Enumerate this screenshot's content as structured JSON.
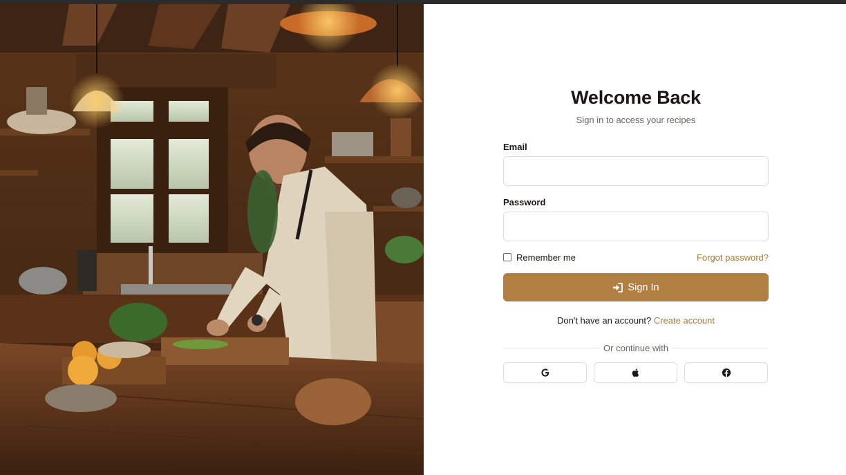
{
  "hero": {
    "image": "chef chopping herbs in rustic wooden kitchen"
  },
  "login": {
    "title": "Welcome Back",
    "subtitle": "Sign in to access your recipes",
    "email_label": "Email",
    "email_value": "",
    "password_label": "Password",
    "password_value": "",
    "remember_label": "Remember me",
    "remember_checked": false,
    "forgot_label": "Forgot password?",
    "signin_label": "Sign In",
    "signin_icon": "sign-in-icon",
    "no_account_text": "Don't have an account?",
    "create_account_label": "Create account",
    "divider_text": "Or continue with",
    "social": [
      {
        "icon": "google-icon"
      },
      {
        "icon": "apple-icon"
      },
      {
        "icon": "facebook-icon"
      }
    ]
  },
  "colors": {
    "accent": "#b27f42",
    "link": "#a87a3e",
    "border": "#dcdcdc",
    "title": "#1c1714",
    "muted": "#6b6560"
  }
}
